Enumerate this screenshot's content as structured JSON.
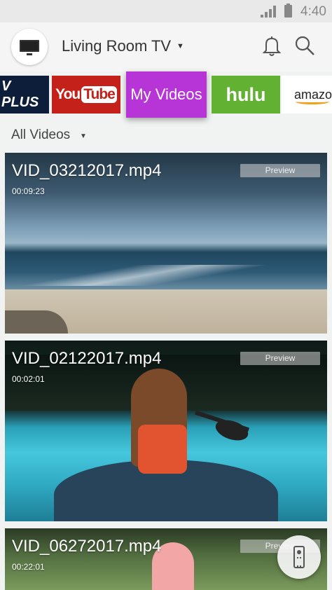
{
  "status_bar": {
    "time": "4:40"
  },
  "header": {
    "device_name": "Living Room TV"
  },
  "apps": [
    {
      "label": "V PLUS"
    },
    {
      "label_a": "You",
      "label_b": "Tube"
    },
    {
      "label": "My Videos"
    },
    {
      "label": "hulu"
    },
    {
      "label": "amazo"
    }
  ],
  "filter": {
    "label": "All Videos"
  },
  "videos": [
    {
      "title": "VID_03212017.mp4",
      "duration": "00:09:23",
      "badge": "Preview"
    },
    {
      "title": "VID_02122017.mp4",
      "duration": "00:02:01",
      "badge": "Preview"
    },
    {
      "title": "VID_06272017.mp4",
      "duration": "00:22:01",
      "badge": "Preview"
    }
  ],
  "colors": {
    "accent": "#b734d6",
    "youtube": "#c4211a",
    "hulu": "#63b132"
  }
}
